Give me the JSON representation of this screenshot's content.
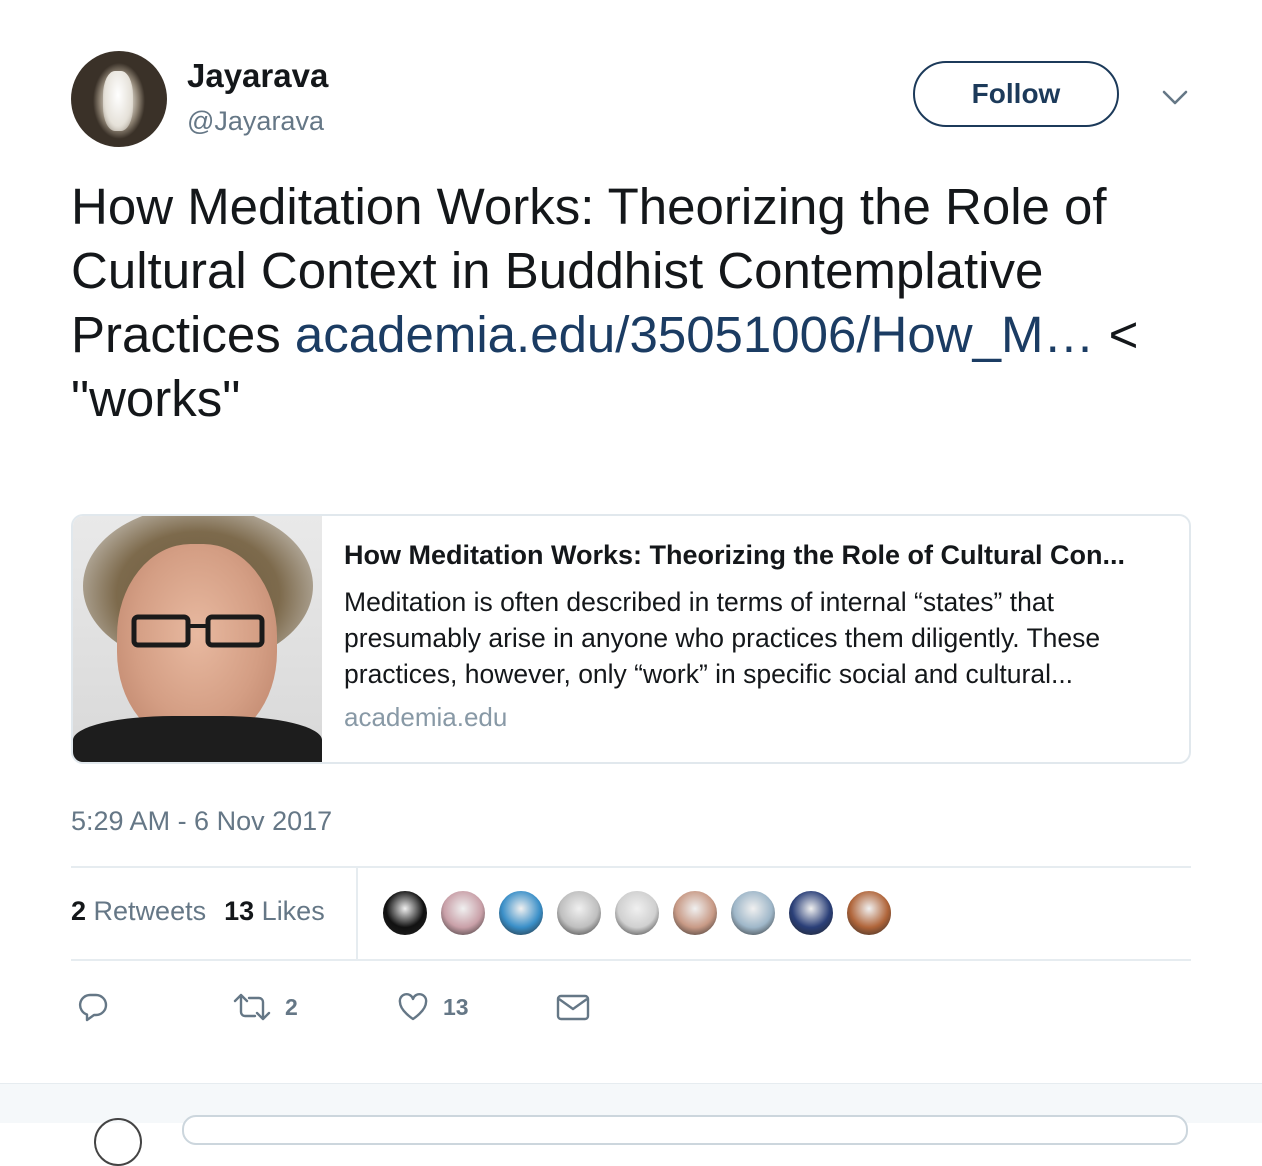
{
  "author": {
    "name": "Jayarava",
    "handle": "@Jayarava"
  },
  "follow_label": "Follow",
  "tweet": {
    "text_prefix": "How Meditation Works: Theorizing the Role of Cultural Context in Buddhist Contemplative Practices ",
    "link": "academia.edu/35051006/How_M…",
    "text_suffix": " < \"works\""
  },
  "card": {
    "title": "How Meditation Works: Theorizing the Role of Cultural Con...",
    "description": "Meditation is often described in terms of internal “states” that presumably arise in anyone who practices them diligently. These practices, however, only “work” in specific social and cultural...",
    "domain": "academia.edu"
  },
  "timestamp": "5:29 AM - 6 Nov 2017",
  "stats": {
    "retweets_count": "2",
    "retweets_label": "Retweets",
    "likes_count": "13",
    "likes_label": "Likes"
  },
  "liker_avatars": [
    {
      "color": "#111111",
      "icon": "cat-eyes-ingroup-avatar"
    },
    {
      "color": "#c9a0a8",
      "icon": "pig-avatar"
    },
    {
      "color": "#3a8fc8",
      "icon": "blue-bearded-man-avatar"
    },
    {
      "color": "#bfbfbf",
      "icon": "bust-statue-avatar"
    },
    {
      "color": "#d0d0d0",
      "icon": "man-glasses-avatar"
    },
    {
      "color": "#c89a86",
      "icon": "bald-man-avatar"
    },
    {
      "color": "#9fb7c9",
      "icon": "man-glasses-smiling-avatar"
    },
    {
      "color": "#2a3f78",
      "icon": "blue-mandala-avatar"
    },
    {
      "color": "#b0653a",
      "icon": "rusty-logo-avatar"
    }
  ],
  "actions": {
    "reply_icon": "reply-icon",
    "retweet_icon": "retweet-icon",
    "retweet_count": "2",
    "like_icon": "heart-icon",
    "like_count": "13",
    "message_icon": "envelope-icon"
  },
  "colors": {
    "link": "#1b3c63",
    "follow_border": "#1c3a5a",
    "muted": "#657786",
    "border": "#e1e8ed"
  }
}
